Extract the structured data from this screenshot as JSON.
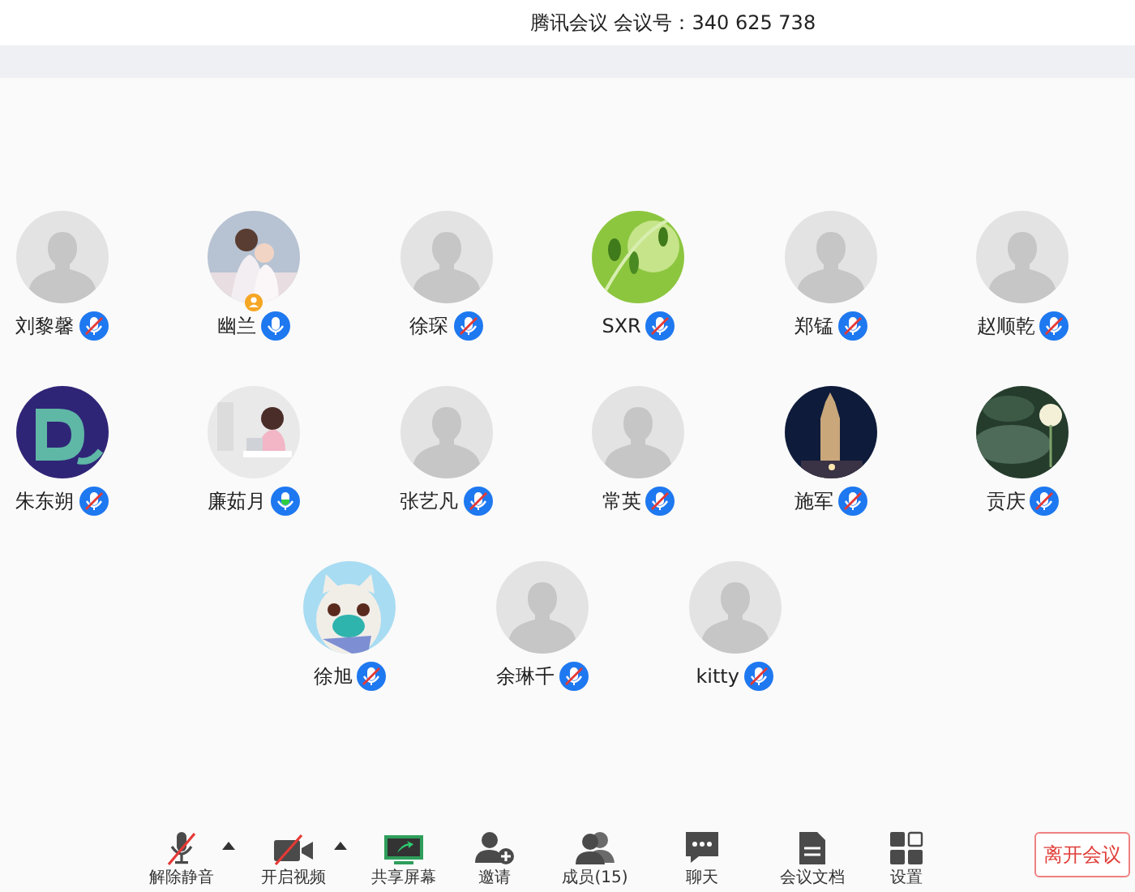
{
  "window": {
    "title": "腾讯会议 会议号：340 625 738"
  },
  "participants": [
    {
      "name": "刘黎馨",
      "kind": "default",
      "muted": true,
      "speaking": false,
      "host": false
    },
    {
      "name": "幽兰",
      "kind": "picture",
      "muted": false,
      "speaking": false,
      "host": true
    },
    {
      "name": "徐琛",
      "kind": "default",
      "muted": true,
      "speaking": false,
      "host": false
    },
    {
      "name": "SXR",
      "kind": "picture",
      "muted": true,
      "speaking": false,
      "host": false
    },
    {
      "name": "郑锰",
      "kind": "default",
      "muted": true,
      "speaking": false,
      "host": false
    },
    {
      "name": "赵顺乾",
      "kind": "default",
      "muted": true,
      "speaking": false,
      "host": false
    },
    {
      "name": "朱东朔",
      "kind": "picture",
      "muted": true,
      "speaking": false,
      "host": false
    },
    {
      "name": "廉茹月",
      "kind": "picture",
      "muted": false,
      "speaking": true,
      "host": false
    },
    {
      "name": "张艺凡",
      "kind": "default",
      "muted": true,
      "speaking": false,
      "host": false
    },
    {
      "name": "常英",
      "kind": "default",
      "muted": true,
      "speaking": false,
      "host": false
    },
    {
      "name": "施军",
      "kind": "picture",
      "muted": true,
      "speaking": false,
      "host": false
    },
    {
      "name": "贡庆",
      "kind": "picture",
      "muted": true,
      "speaking": false,
      "host": false
    },
    {
      "name": "徐旭",
      "kind": "picture",
      "muted": true,
      "speaking": false,
      "host": false
    },
    {
      "name": "余琳千",
      "kind": "default",
      "muted": true,
      "speaking": false,
      "host": false
    },
    {
      "name": "kitty",
      "kind": "default",
      "muted": true,
      "speaking": false,
      "host": false
    }
  ],
  "toolbar": [
    {
      "kind": "mic",
      "label": "解除静音",
      "off": true,
      "menu": true
    },
    {
      "kind": "video",
      "label": "开启视频",
      "off": true,
      "menu": true
    },
    {
      "kind": "share",
      "label": "共享屏幕",
      "menu": false
    },
    {
      "kind": "invite",
      "label": "邀请",
      "menu": false
    },
    {
      "kind": "members",
      "label": "成员(15)",
      "menu": false
    },
    {
      "kind": "chat",
      "label": "聊天",
      "menu": false
    },
    {
      "kind": "docs",
      "label": "会议文档",
      "menu": false
    },
    {
      "kind": "settings",
      "label": "设置",
      "menu": false
    }
  ],
  "leave_button": "离开会议"
}
